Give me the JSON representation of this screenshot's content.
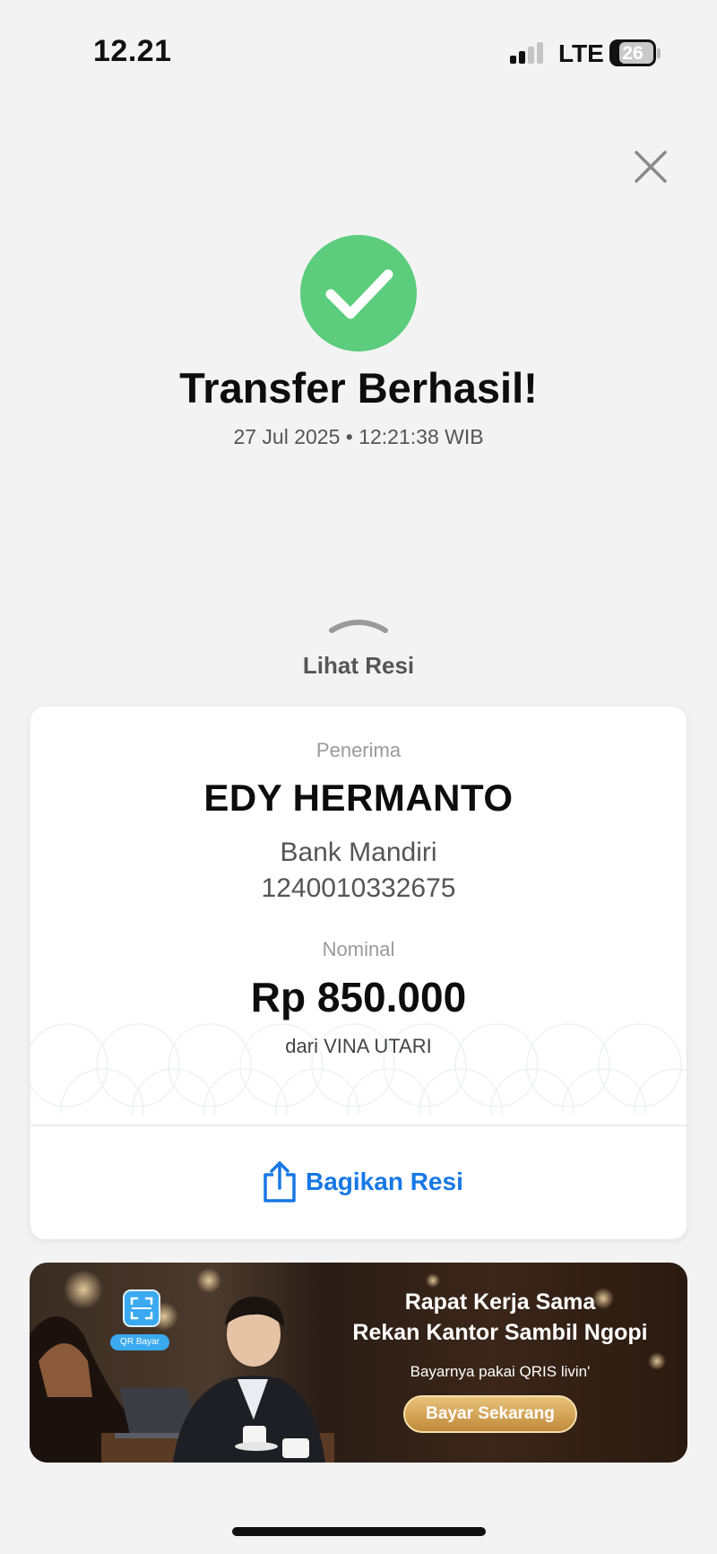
{
  "status_bar": {
    "time": "12.21",
    "network": "LTE",
    "battery": "26",
    "icons": [
      "signal-bars-icon",
      "battery-icon"
    ]
  },
  "header": {
    "close_icon": "close-icon"
  },
  "result": {
    "icon": "check-circle-icon",
    "title": "Transfer Berhasil!",
    "datetime": "27 Jul 2025 • 12:21:38 WIB",
    "success_color": "#5bcd7c"
  },
  "receipt_toggle": {
    "icon": "chevron-up-icon",
    "label": "Lihat Resi"
  },
  "receipt": {
    "recipient_label": "Penerima",
    "recipient_name": "EDY HERMANTO",
    "bank": "Bank Mandiri",
    "account_number": "1240010332675",
    "amount_label": "Nominal",
    "amount": "Rp 850.000",
    "sender": "dari VINA UTARI",
    "share_icon": "share-icon",
    "share_label": "Bagikan Resi",
    "accent_color": "#1778e5"
  },
  "promo": {
    "qr_label": "QR Bayar",
    "headline_1": "Rapat Kerja Sama",
    "headline_2": "Rekan Kantor Sambil Ngopi",
    "subline": "Bayarnya pakai QRIS livin'",
    "cta": "Bayar Sekarang"
  }
}
